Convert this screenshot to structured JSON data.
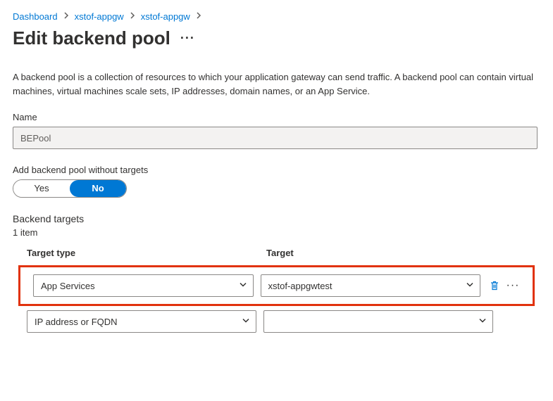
{
  "breadcrumb": {
    "items": [
      "Dashboard",
      "xstof-appgw",
      "xstof-appgw"
    ]
  },
  "page": {
    "title": "Edit backend pool",
    "description": "A backend pool is a collection of resources to which your application gateway can send traffic. A backend pool can contain virtual machines, virtual machines scale sets, IP addresses, domain names, or an App Service."
  },
  "name_field": {
    "label": "Name",
    "value": "BEPool"
  },
  "no_targets": {
    "label": "Add backend pool without targets",
    "yes": "Yes",
    "no": "No"
  },
  "targets": {
    "section": "Backend targets",
    "count": "1 item",
    "headers": {
      "type": "Target type",
      "target": "Target"
    },
    "rows": [
      {
        "type": "App Services",
        "target": "xstof-appgwtest"
      },
      {
        "type": "IP address or FQDN",
        "target": ""
      }
    ]
  }
}
